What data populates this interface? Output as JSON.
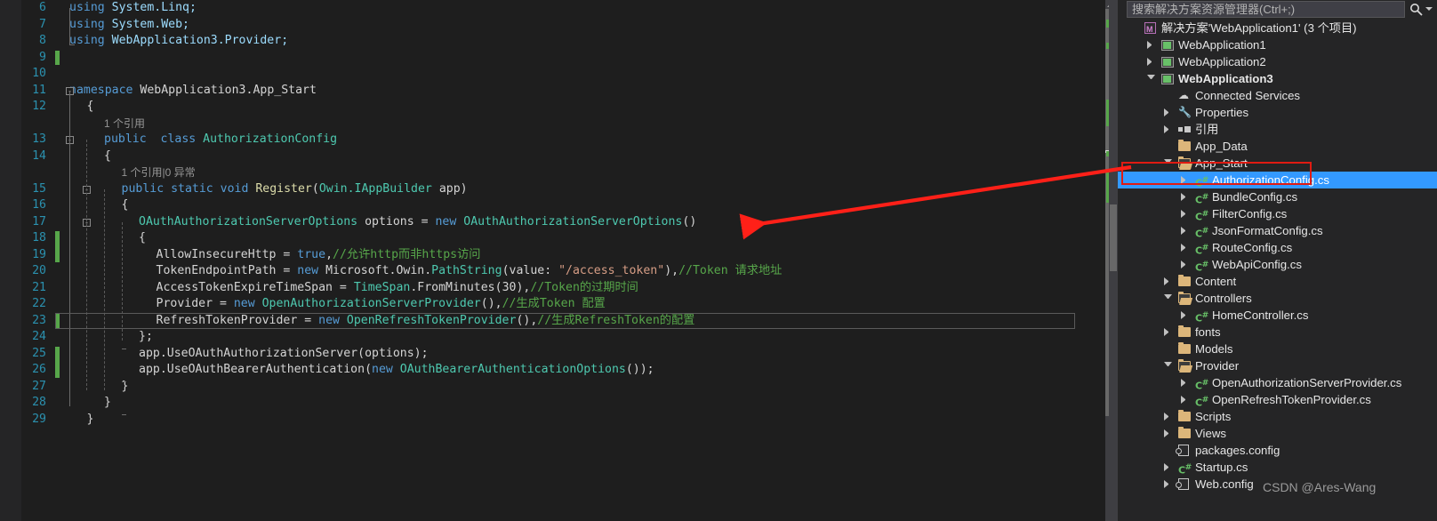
{
  "editor": {
    "language": "csharp",
    "first_visible_line": 6,
    "last_visible_line": 29,
    "current_line": 23,
    "lines": [
      {
        "n": 6,
        "indent": 0,
        "segments": [
          {
            "t": "using ",
            "c": "k"
          },
          {
            "t": "System.Linq;",
            "c": "n"
          }
        ]
      },
      {
        "n": 7,
        "indent": 0,
        "segments": [
          {
            "t": "using ",
            "c": "k"
          },
          {
            "t": "System.Web;",
            "c": "n"
          }
        ]
      },
      {
        "n": 8,
        "indent": 0,
        "segments": [
          {
            "t": "using ",
            "c": "k"
          },
          {
            "t": "WebApplication3.Provider;",
            "c": "n"
          }
        ]
      },
      {
        "n": 9,
        "indent": 0,
        "segments": []
      },
      {
        "n": 10,
        "indent": 0,
        "segments": []
      },
      {
        "n": 11,
        "indent": 0,
        "segments": [
          {
            "t": "namespace ",
            "c": "k"
          },
          {
            "t": "WebApplication3.App_Start",
            "c": "p"
          }
        ]
      },
      {
        "n": 12,
        "indent": 1,
        "segments": [
          {
            "t": "{",
            "c": "p"
          }
        ]
      },
      {
        "n": 0,
        "indent": 2,
        "segments": [
          {
            "t": "1 个引用",
            "c": "ref"
          }
        ]
      },
      {
        "n": 13,
        "indent": 2,
        "segments": [
          {
            "t": "public",
            "c": "k"
          },
          {
            "t": "  ",
            "c": "p"
          },
          {
            "t": "class ",
            "c": "k"
          },
          {
            "t": "AuthorizationConfig",
            "c": "t"
          }
        ]
      },
      {
        "n": 14,
        "indent": 2,
        "segments": [
          {
            "t": "{",
            "c": "p"
          }
        ]
      },
      {
        "n": 0,
        "indent": 3,
        "segments": [
          {
            "t": "1 个引用|0 异常",
            "c": "ref"
          }
        ]
      },
      {
        "n": 15,
        "indent": 3,
        "segments": [
          {
            "t": "public static void ",
            "c": "k"
          },
          {
            "t": "Register",
            "c": "m"
          },
          {
            "t": "(",
            "c": "p"
          },
          {
            "t": "Owin.IAppBuilder",
            "c": "t"
          },
          {
            "t": " app)",
            "c": "p"
          }
        ]
      },
      {
        "n": 16,
        "indent": 3,
        "segments": [
          {
            "t": "{",
            "c": "p"
          }
        ]
      },
      {
        "n": 17,
        "indent": 4,
        "segments": [
          {
            "t": "OAuthAuthorizationServerOptions",
            "c": "t"
          },
          {
            "t": " options = ",
            "c": "p"
          },
          {
            "t": "new ",
            "c": "k"
          },
          {
            "t": "OAuthAuthorizationServerOptions",
            "c": "t"
          },
          {
            "t": "()",
            "c": "p"
          }
        ]
      },
      {
        "n": 18,
        "indent": 4,
        "segments": [
          {
            "t": "{",
            "c": "p"
          }
        ]
      },
      {
        "n": 19,
        "indent": 5,
        "segments": [
          {
            "t": "AllowInsecureHttp = ",
            "c": "p"
          },
          {
            "t": "true",
            "c": "k"
          },
          {
            "t": ",",
            "c": "p"
          },
          {
            "t": "//允许http而非https访问",
            "c": "c"
          }
        ]
      },
      {
        "n": 20,
        "indent": 5,
        "segments": [
          {
            "t": "TokenEndpointPath = ",
            "c": "p"
          },
          {
            "t": "new ",
            "c": "k"
          },
          {
            "t": "Microsoft.Owin.",
            "c": "p"
          },
          {
            "t": "PathString",
            "c": "t"
          },
          {
            "t": "(value: ",
            "c": "p"
          },
          {
            "t": "\"/access_token\"",
            "c": "s"
          },
          {
            "t": "),",
            "c": "p"
          },
          {
            "t": "//Token 请求地址",
            "c": "c"
          }
        ]
      },
      {
        "n": 21,
        "indent": 5,
        "segments": [
          {
            "t": "AccessTokenExpireTimeSpan = ",
            "c": "p"
          },
          {
            "t": "TimeSpan",
            "c": "t"
          },
          {
            "t": ".FromMinutes(",
            "c": "p"
          },
          {
            "t": "30",
            "c": "p"
          },
          {
            "t": "),",
            "c": "p"
          },
          {
            "t": "//Token的过期时间",
            "c": "c"
          }
        ]
      },
      {
        "n": 22,
        "indent": 5,
        "segments": [
          {
            "t": "Provider = ",
            "c": "p"
          },
          {
            "t": "new ",
            "c": "k"
          },
          {
            "t": "OpenAuthorizationServerProvider",
            "c": "t"
          },
          {
            "t": "(),",
            "c": "p"
          },
          {
            "t": "//生成Token 配置",
            "c": "c"
          }
        ]
      },
      {
        "n": 23,
        "indent": 5,
        "segments": [
          {
            "t": "RefreshTokenProvider = ",
            "c": "p"
          },
          {
            "t": "new ",
            "c": "k"
          },
          {
            "t": "OpenRefreshTokenProvider",
            "c": "t"
          },
          {
            "t": "(),",
            "c": "p"
          },
          {
            "t": "//生成RefreshToken的配置",
            "c": "c"
          }
        ]
      },
      {
        "n": 24,
        "indent": 4,
        "segments": [
          {
            "t": "};",
            "c": "p"
          }
        ]
      },
      {
        "n": 25,
        "indent": 4,
        "segments": [
          {
            "t": "app.UseOAuthAuthorizationServer(options);",
            "c": "p"
          }
        ]
      },
      {
        "n": 26,
        "indent": 4,
        "segments": [
          {
            "t": "app.UseOAuthBearerAuthentication(",
            "c": "p"
          },
          {
            "t": "new ",
            "c": "k"
          },
          {
            "t": "OAuthBearerAuthenticationOptions",
            "c": "t"
          },
          {
            "t": "());",
            "c": "p"
          }
        ]
      },
      {
        "n": 27,
        "indent": 3,
        "segments": [
          {
            "t": "}",
            "c": "p"
          }
        ]
      },
      {
        "n": 28,
        "indent": 2,
        "segments": [
          {
            "t": "}",
            "c": "p"
          }
        ]
      },
      {
        "n": 29,
        "indent": 1,
        "segments": [
          {
            "t": "}",
            "c": "p"
          }
        ]
      }
    ]
  },
  "solution_explorer": {
    "search": {
      "placeholder": "搜索解决方案资源管理器(Ctrl+;)",
      "value": "",
      "icon": "search-icon",
      "dropdown_icon": "chevron-down-icon"
    },
    "tree": [
      {
        "label": "解决方案'WebApplication1' (3 个项目)",
        "depth": 0,
        "icon": "solution-icon",
        "expander": "none",
        "bold": false,
        "selected": false
      },
      {
        "label": "WebApplication1",
        "depth": 1,
        "icon": "project-icon",
        "expander": "right",
        "bold": false,
        "selected": false
      },
      {
        "label": "WebApplication2",
        "depth": 1,
        "icon": "project-icon",
        "expander": "right",
        "bold": false,
        "selected": false
      },
      {
        "label": "WebApplication3",
        "depth": 1,
        "icon": "project-icon",
        "expander": "down",
        "bold": true,
        "selected": false
      },
      {
        "label": "Connected Services",
        "depth": 2,
        "icon": "cloud-icon",
        "expander": "none",
        "bold": false,
        "selected": false
      },
      {
        "label": "Properties",
        "depth": 2,
        "icon": "wrench-icon",
        "expander": "right",
        "bold": false,
        "selected": false
      },
      {
        "label": "引用",
        "depth": 2,
        "icon": "references-icon",
        "expander": "right",
        "bold": false,
        "selected": false
      },
      {
        "label": "App_Data",
        "depth": 2,
        "icon": "folder-icon",
        "expander": "none",
        "bold": false,
        "selected": false
      },
      {
        "label": "App_Start",
        "depth": 2,
        "icon": "folder-open-icon",
        "expander": "down",
        "bold": false,
        "selected": false
      },
      {
        "label": "AuthorizationConfig.cs",
        "depth": 3,
        "icon": "csharp-file-icon",
        "expander": "right",
        "bold": false,
        "selected": true
      },
      {
        "label": "BundleConfig.cs",
        "depth": 3,
        "icon": "csharp-file-icon",
        "expander": "right",
        "bold": false,
        "selected": false
      },
      {
        "label": "FilterConfig.cs",
        "depth": 3,
        "icon": "csharp-file-icon",
        "expander": "right",
        "bold": false,
        "selected": false
      },
      {
        "label": "JsonFormatConfig.cs",
        "depth": 3,
        "icon": "csharp-file-icon",
        "expander": "right",
        "bold": false,
        "selected": false
      },
      {
        "label": "RouteConfig.cs",
        "depth": 3,
        "icon": "csharp-file-icon",
        "expander": "right",
        "bold": false,
        "selected": false
      },
      {
        "label": "WebApiConfig.cs",
        "depth": 3,
        "icon": "csharp-file-icon",
        "expander": "right",
        "bold": false,
        "selected": false
      },
      {
        "label": "Content",
        "depth": 2,
        "icon": "folder-icon",
        "expander": "right",
        "bold": false,
        "selected": false
      },
      {
        "label": "Controllers",
        "depth": 2,
        "icon": "folder-open-icon",
        "expander": "down",
        "bold": false,
        "selected": false
      },
      {
        "label": "HomeController.cs",
        "depth": 3,
        "icon": "csharp-file-icon",
        "expander": "right",
        "bold": false,
        "selected": false
      },
      {
        "label": "fonts",
        "depth": 2,
        "icon": "folder-icon",
        "expander": "right",
        "bold": false,
        "selected": false
      },
      {
        "label": "Models",
        "depth": 2,
        "icon": "folder-icon",
        "expander": "none",
        "bold": false,
        "selected": false
      },
      {
        "label": "Provider",
        "depth": 2,
        "icon": "folder-open-icon",
        "expander": "down",
        "bold": false,
        "selected": false
      },
      {
        "label": "OpenAuthorizationServerProvider.cs",
        "depth": 3,
        "icon": "csharp-file-icon",
        "expander": "right",
        "bold": false,
        "selected": false
      },
      {
        "label": "OpenRefreshTokenProvider.cs",
        "depth": 3,
        "icon": "csharp-file-icon",
        "expander": "right",
        "bold": false,
        "selected": false
      },
      {
        "label": "Scripts",
        "depth": 2,
        "icon": "folder-icon",
        "expander": "right",
        "bold": false,
        "selected": false
      },
      {
        "label": "Views",
        "depth": 2,
        "icon": "folder-icon",
        "expander": "right",
        "bold": false,
        "selected": false
      },
      {
        "label": "packages.config",
        "depth": 2,
        "icon": "config-file-icon",
        "expander": "none",
        "bold": false,
        "selected": false
      },
      {
        "label": "Startup.cs",
        "depth": 2,
        "icon": "csharp-file-icon",
        "expander": "right",
        "bold": false,
        "selected": false
      },
      {
        "label": "Web.config",
        "depth": 2,
        "icon": "config-file-icon",
        "expander": "right",
        "bold": false,
        "selected": false
      }
    ]
  },
  "annotations": {
    "highlight_rect_color": "#e01b12",
    "arrow_color": "#ff2018",
    "watermark": "CSDN @Ares-Wang"
  },
  "colors": {
    "editor_background": "#1e1e1e",
    "panel_background": "#252526",
    "selection_blue": "#3399ff",
    "comment_green": "#57a64a",
    "keyword_blue": "#569cd6",
    "type_teal": "#4ec9b0",
    "string_orange": "#d69d85",
    "linenumber_blue": "#2b91af",
    "change_bar_green": "#57a64a"
  }
}
